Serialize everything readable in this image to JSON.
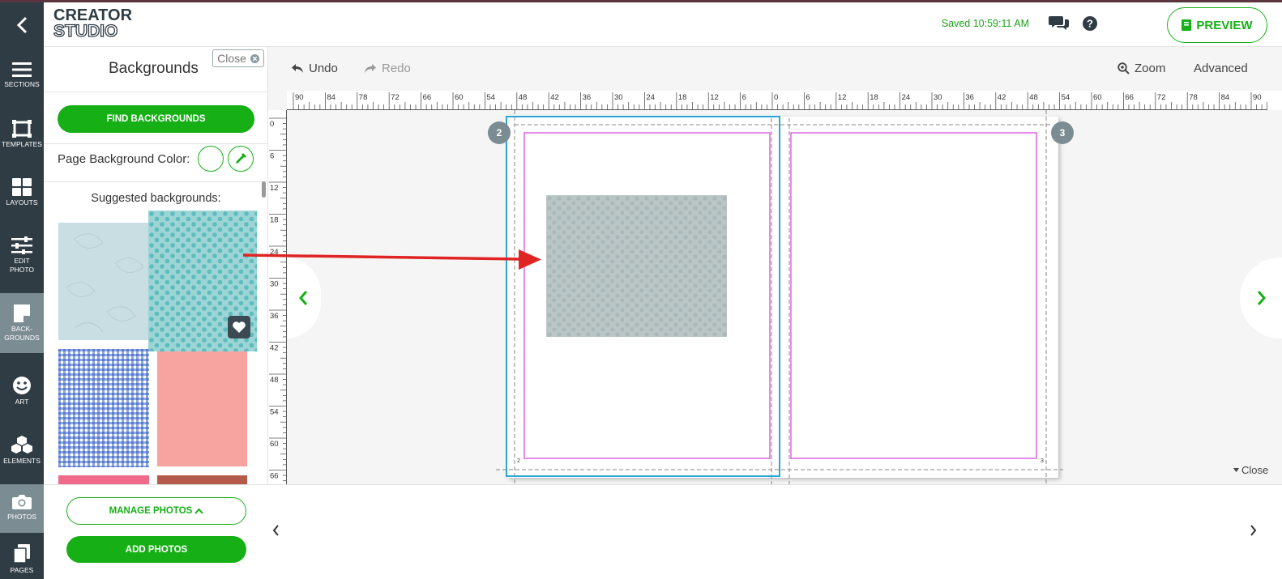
{
  "app": {
    "logo_line1": "CREATOR",
    "logo_line2": "STUDIO",
    "saved_status": "Saved 10:59:11 AM",
    "preview_label": "PREVIEW",
    "accent_color": "#16b016",
    "nav_color": "#2f3c44"
  },
  "nav": {
    "items": [
      {
        "label": "SECTIONS",
        "icon": "hamburger-icon"
      },
      {
        "label": "TEMPLATES",
        "icon": "template-icon"
      },
      {
        "label": "LAYOUTS",
        "icon": "grid-icon"
      },
      {
        "label": "EDIT PHOTO",
        "icon": "sliders-icon"
      },
      {
        "label": "BACK-GROUNDS",
        "icon": "note-icon"
      },
      {
        "label": "ART",
        "icon": "smiley-icon"
      },
      {
        "label": "ELEMENTS",
        "icon": "cubes-icon"
      },
      {
        "label": "PHOTOS",
        "icon": "camera-icon"
      },
      {
        "label": "PAGES",
        "icon": "pages-icon"
      }
    ],
    "active": "BACK-GROUNDS"
  },
  "panel": {
    "title": "Backgrounds",
    "close_label": "Close",
    "find_label": "FIND BACKGROUNDS",
    "page_bg_label": "Page Background Color:",
    "suggested_label": "Suggested backgrounds:"
  },
  "photos": {
    "manage_label": "MANAGE PHOTOS",
    "add_label": "ADD PHOTOS"
  },
  "toolbar": {
    "undo_label": "Undo",
    "redo_label": "Redo",
    "zoom_label": "Zoom",
    "advanced_label": "Advanced"
  },
  "ruler": {
    "h_labels": [
      "90",
      "84",
      "78",
      "72",
      "66",
      "60",
      "54",
      "48",
      "42",
      "36",
      "30",
      "24",
      "18",
      "12",
      "6",
      "0",
      "6",
      "12",
      "18",
      "24",
      "30",
      "36",
      "42",
      "48",
      "54",
      "60",
      "66",
      "72",
      "78",
      "84",
      "90"
    ],
    "v_labels": [
      "0",
      "6",
      "12",
      "18",
      "24",
      "30",
      "36",
      "42",
      "48",
      "54",
      "60",
      "66"
    ]
  },
  "canvas": {
    "left_page_number": "2",
    "right_page_number": "3",
    "left_corner_mark": "2",
    "right_corner_mark": "3",
    "close_label": "Close"
  }
}
